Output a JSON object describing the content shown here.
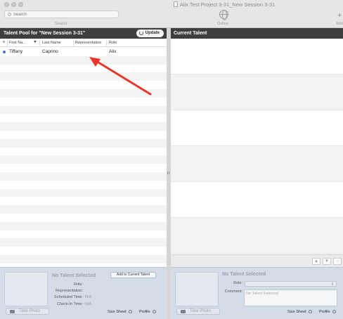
{
  "window": {
    "title": "Alix Test Project 3-31_New Session 3-31"
  },
  "toolbar": {
    "search_placeholder": "Search",
    "search_caption": "Search",
    "online_label": "Online",
    "add_label": "Add"
  },
  "talent_pool": {
    "header": "Talent Pool for \"New Session 3-31\"",
    "update_label": "Update",
    "columns": [
      "First Na...",
      "Last Name",
      "Representation",
      "Role"
    ],
    "rows": [
      {
        "first": "Tiffany",
        "last": "Caprino",
        "representation": "",
        "role": "Alix"
      }
    ]
  },
  "current_talent": {
    "header": "Current Talent",
    "controls": [
      "▲",
      "▼",
      "−"
    ]
  },
  "details_left": {
    "no_talent": "No Talent Selected",
    "add_button": "Add to Current Talent",
    "labels": {
      "role": "Role:",
      "representation": "Representation:",
      "scheduled": "Scheduled Time:",
      "checkin": "Check-In Time:"
    },
    "values": {
      "scheduled": "N/A",
      "checkin": "N/A"
    },
    "take_photo": "Take Photo",
    "size_sheet": "Size Sheet",
    "profile": "Profile"
  },
  "details_right": {
    "no_talent": "No Talent Selected",
    "labels": {
      "role": "Role:",
      "comment": "Comment:"
    },
    "comment_placeholder": "No Talent Selected",
    "take_photo": "Take Photo",
    "size_sheet": "Size Sheet",
    "profile": "Profile"
  },
  "colors": {
    "header_bg": "#3e3e3e",
    "annotation_arrow": "#e8362b",
    "status_dot": "#3a78c9",
    "details_bg": "#d4dce8"
  }
}
